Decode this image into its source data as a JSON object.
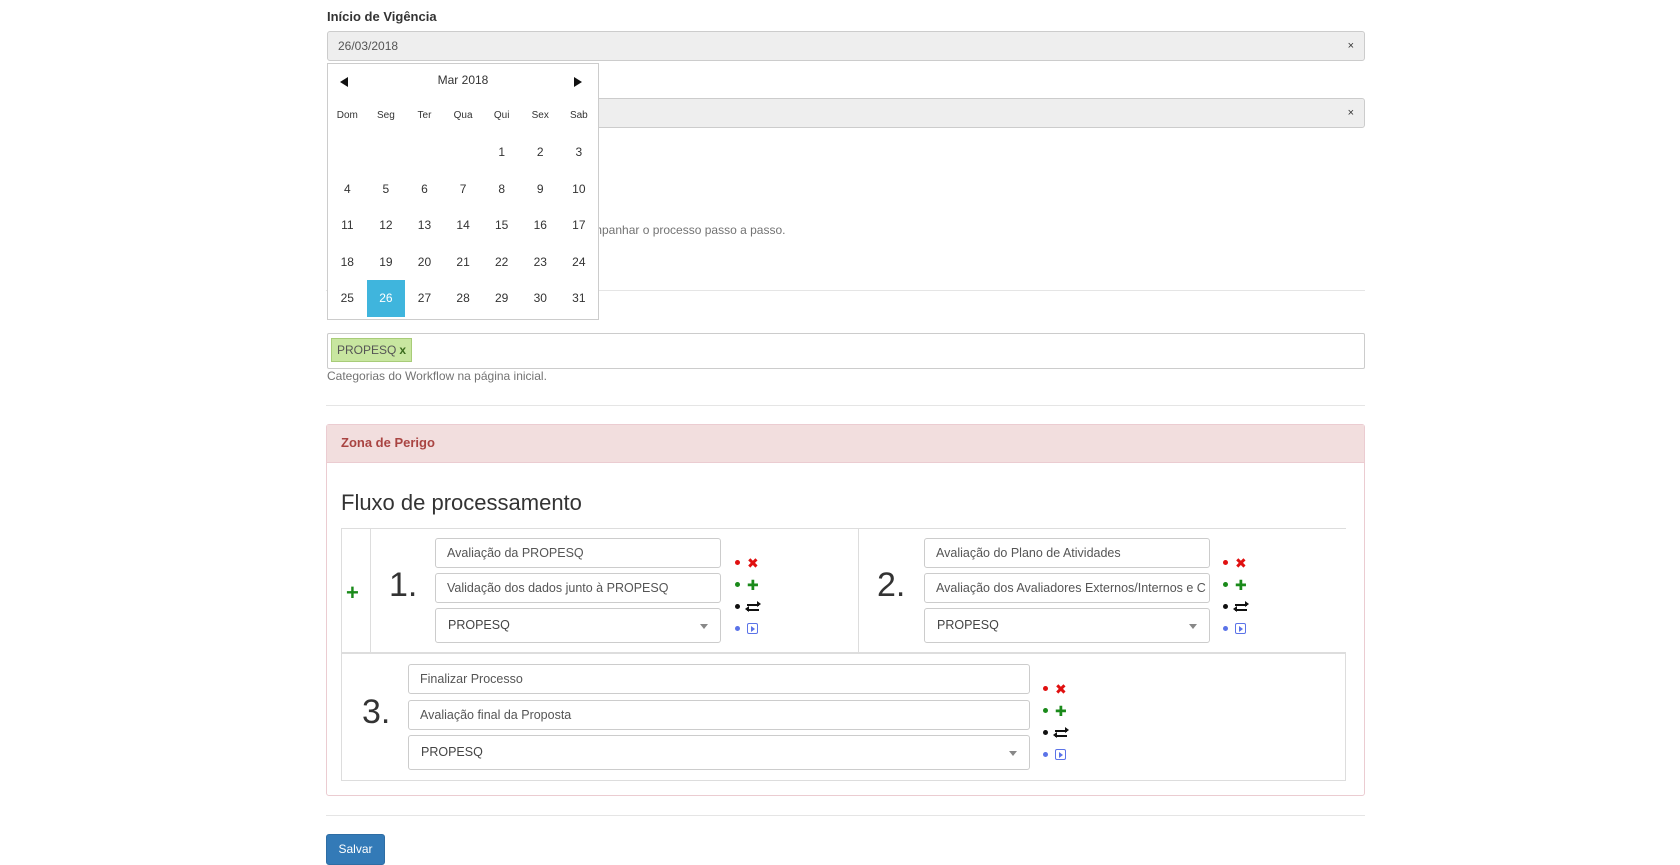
{
  "inicio_vigencia": {
    "label": "Início de Vigência",
    "value": "26/03/2018",
    "clear": "×"
  },
  "second_field": {
    "clear": "×"
  },
  "partial_help": "mpanhar o processo passo a passo.",
  "datepicker": {
    "title": "Mar 2018",
    "weekdays": [
      "Dom",
      "Seg",
      "Ter",
      "Qua",
      "Qui",
      "Sex",
      "Sab"
    ],
    "weeks": [
      [
        "",
        "",
        "",
        "",
        "1",
        "2",
        "3"
      ],
      [
        "4",
        "5",
        "6",
        "7",
        "8",
        "9",
        "10"
      ],
      [
        "11",
        "12",
        "13",
        "14",
        "15",
        "16",
        "17"
      ],
      [
        "18",
        "19",
        "20",
        "21",
        "22",
        "23",
        "24"
      ],
      [
        "25",
        "26",
        "27",
        "28",
        "29",
        "30",
        "31"
      ]
    ],
    "selected": "26"
  },
  "tags": {
    "items": [
      {
        "label": "PROPESQ",
        "remove": "x"
      }
    ],
    "help": "Categorias do Workflow na página inicial."
  },
  "danger_zone": {
    "title": "Zona de Perigo",
    "flow_title": "Fluxo de processamento",
    "add_icon": "+",
    "steps": [
      {
        "number": "1.",
        "name": "Avaliação da PROPESQ",
        "description": "Validação dos dados junto à PROPESQ",
        "group": "PROPESQ"
      },
      {
        "number": "2.",
        "name": "Avaliação do Plano de Atividades",
        "description": "Avaliação dos Avaliadores Externos/Internos e C",
        "group": "PROPESQ"
      },
      {
        "number": "3.",
        "name": "Finalizar Processo",
        "description": "Avaliação final da Proposta",
        "group": "PROPESQ"
      }
    ],
    "control_icons": [
      "close-icon",
      "plus-icon",
      "swap-icon",
      "play-icon"
    ],
    "colors": {
      "remove": "#e01010",
      "add": "#1a8a1a",
      "swap": "#111111",
      "play": "#5b73e8"
    }
  },
  "save_button": {
    "label": "Salvar"
  }
}
